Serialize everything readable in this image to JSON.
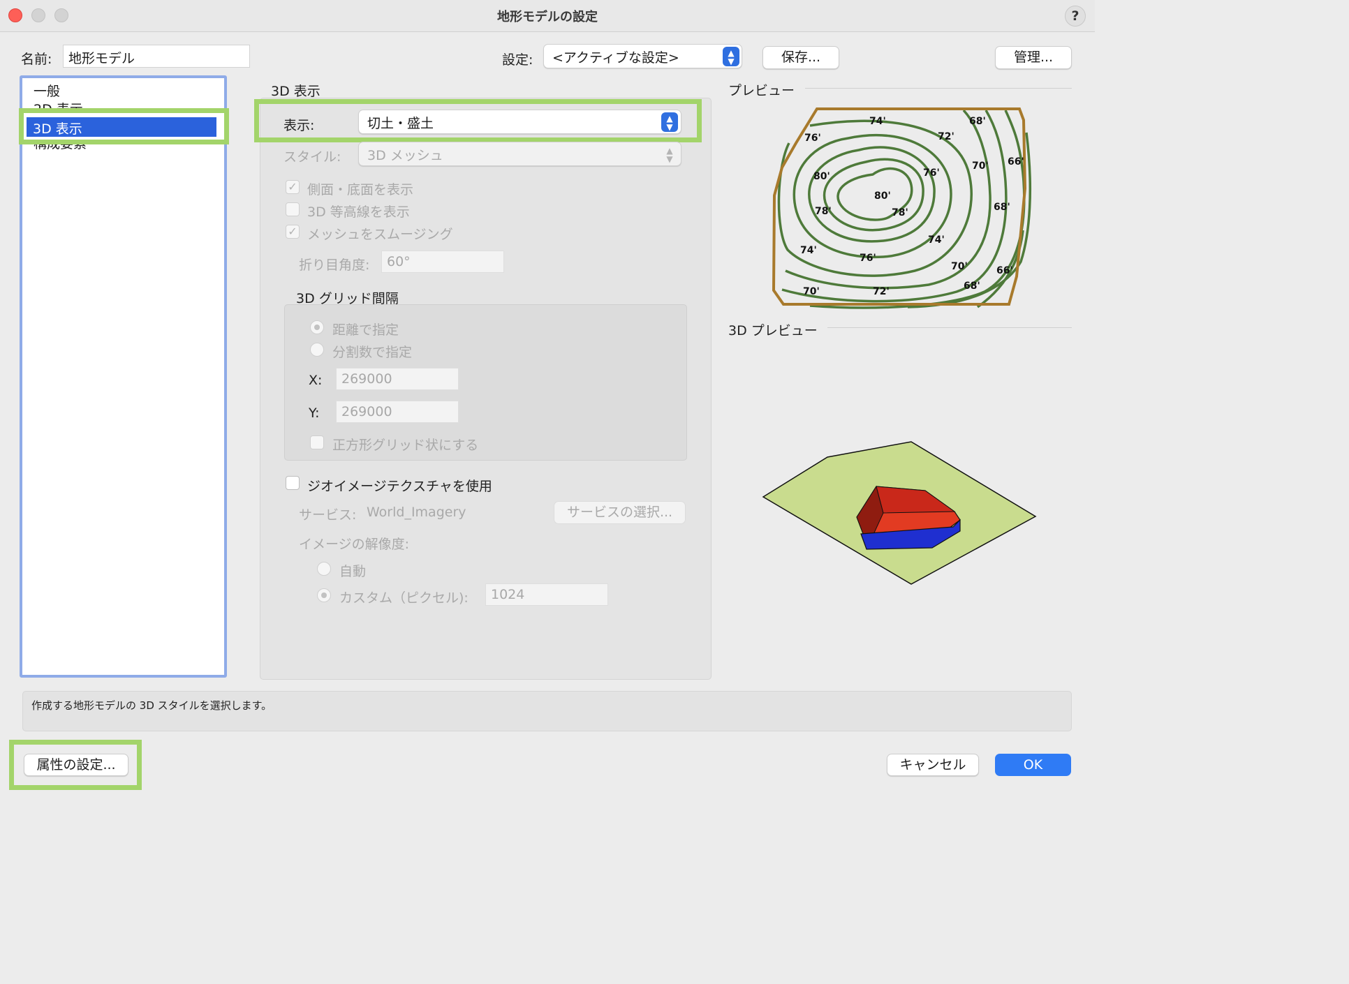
{
  "window": {
    "title": "地形モデルの設定",
    "help": "?"
  },
  "top": {
    "name_label": "名前:",
    "name_value": "地形モデル",
    "settings_label": "設定:",
    "settings_value": "<アクティブな設定>",
    "save_button": "保存...",
    "manage_button": "管理..."
  },
  "sidebar": {
    "items": [
      "一般",
      "2D 表示",
      "3D 表示",
      "構成要素"
    ],
    "selected": "3D 表示"
  },
  "panel": {
    "title": "3D 表示",
    "display_label": "表示:",
    "display_value": "切土・盛土",
    "style_label": "スタイル:",
    "style_value": "3D メッシュ",
    "show_side_bottom": "側面・底面を表示",
    "show_3d_contours": "3D 等高線を表示",
    "smooth_mesh": "メッシュをスムージング",
    "crease_label": "折り目角度:",
    "crease_value": "60°",
    "grid_title": "3D グリッド間隔",
    "grid_by_distance": "距離で指定",
    "grid_by_divisions": "分割数で指定",
    "x_label": "X:",
    "x_value": "269000",
    "y_label": "Y:",
    "y_value": "269000",
    "square_grid": "正方形グリッド状にする",
    "geo_texture": "ジオイメージテクスチャを使用",
    "service_label": "サービス:",
    "service_value": "World_Imagery",
    "service_button": "サービスの選択...",
    "resolution_label": "イメージの解像度:",
    "res_auto": "自動",
    "res_custom": "カスタム（ピクセル):",
    "res_value": "1024"
  },
  "preview": {
    "title": "プレビュー",
    "preview3d_title": "3D プレビュー",
    "contour_labels": [
      "74'",
      "76'",
      "72'",
      "68'",
      "66'",
      "70'",
      "80'",
      "80'",
      "78'",
      "78'",
      "76'",
      "68'",
      "74'",
      "74'",
      "76'",
      "70'",
      "66'",
      "68'",
      "70'",
      "72'"
    ],
    "colors": {
      "border": "#a87a2c",
      "contour": "#4e7a3a",
      "ground": "#c9dc8e",
      "cut": "#e23b22",
      "fill": "#1f2fd0"
    }
  },
  "status": {
    "text": "作成する地形モデルの 3D スタイルを選択します。"
  },
  "footer": {
    "attributes_button": "属性の設定...",
    "cancel_button": "キャンセル",
    "ok_button": "OK"
  }
}
